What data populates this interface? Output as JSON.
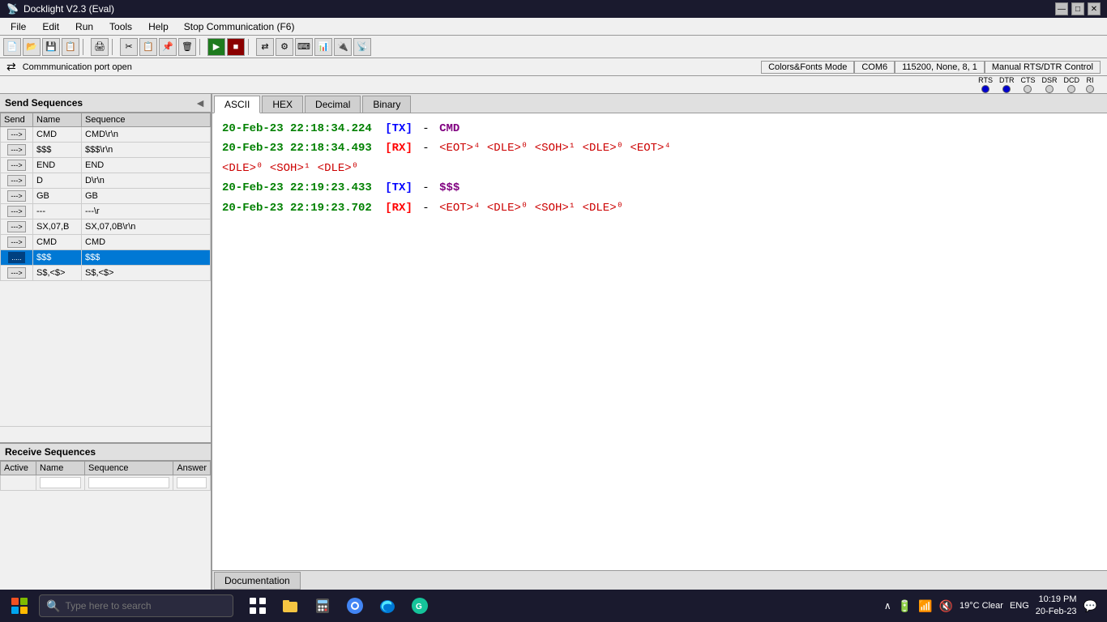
{
  "titleBar": {
    "title": "Docklight V2.3 (Eval)",
    "icon": "📡",
    "controls": [
      "—",
      "□",
      "✕"
    ]
  },
  "menuBar": {
    "items": [
      "File",
      "Edit",
      "Run",
      "Tools",
      "Help"
    ],
    "stopComm": "Stop Communication  (F6)"
  },
  "toolbar": {
    "buttons": [
      "new",
      "open",
      "save",
      "save-as",
      "sep",
      "print",
      "sep",
      "cut",
      "copy",
      "paste",
      "clear",
      "sep",
      "send",
      "stop",
      "sep",
      "settings",
      "channels",
      "keyboard"
    ],
    "portLabel": "Commmunication port open"
  },
  "statusBar": {
    "portStatus": "Commmunication port open",
    "cells": [
      "Colors&Fonts Mode",
      "COM6",
      "115200, None, 8, 1",
      "Manual RTS/DTR Control"
    ]
  },
  "signals": {
    "items": [
      {
        "label": "RTS",
        "on": true
      },
      {
        "label": "DTR",
        "on": true
      },
      {
        "label": "CTS",
        "on": false
      },
      {
        "label": "DSR",
        "on": false
      },
      {
        "label": "DCD",
        "on": false
      },
      {
        "label": "RI",
        "on": false
      }
    ]
  },
  "tabs": {
    "items": [
      "ASCII",
      "HEX",
      "Decimal",
      "Binary"
    ],
    "active": 0
  },
  "sendSequences": {
    "header": "Send Sequences",
    "columns": [
      "Send",
      "Name",
      "Sequence"
    ],
    "rows": [
      {
        "arrow": "--->",
        "name": "CMD",
        "sequence": "CMD\\r\\n"
      },
      {
        "arrow": "--->",
        "name": "$$$",
        "sequence": "$$$\\r\\n"
      },
      {
        "arrow": "--->",
        "name": "END",
        "sequence": "END"
      },
      {
        "arrow": "--->",
        "name": "D",
        "sequence": "D\\r\\n"
      },
      {
        "arrow": "--->",
        "name": "GB",
        "sequence": "GB"
      },
      {
        "arrow": "--->",
        "name": "---",
        "sequence": "---\\r"
      },
      {
        "arrow": "--->",
        "name": "SX,07,B",
        "sequence": "SX,07,0B\\r\\n"
      },
      {
        "arrow": "--->",
        "name": "CMD",
        "sequence": "CMD"
      },
      {
        "arrow": ".....",
        "name": "$$$",
        "sequence": "$$$",
        "selected": true
      },
      {
        "arrow": "--->",
        "name": "S$,<$>",
        "sequence": "S$,<$>"
      }
    ]
  },
  "receiveSequences": {
    "header": "Receive Sequences",
    "columns": [
      "Active",
      "Name",
      "Sequence",
      "Answer"
    ],
    "rows": []
  },
  "commLog": {
    "lines": [
      {
        "timestamp": "20-Feb-23 22:18:34.224",
        "direction": "[TX]",
        "sep": "-",
        "content": "CMD",
        "contentType": "cmd"
      },
      {
        "timestamp": "20-Feb-23 22:18:34.493",
        "direction": "[RX]",
        "sep": "-",
        "content": "<EOT>␄ <DLE>␐ <SOH>␁ <DLE>␐ <EOT>␄",
        "contentType": "rx-data",
        "line2": "<DLE>␐ <SOH>␁ <DLE>␐"
      },
      {
        "timestamp": "20-Feb-23 22:19:23.433",
        "direction": "[TX]",
        "sep": "-",
        "content": "$$$",
        "contentType": "cmd2"
      },
      {
        "timestamp": "20-Feb-23 22:19:23.702",
        "direction": "[RX]",
        "sep": "-",
        "content": "<EOT>␄ <DLE>␐ <SOH>␁ <DLE>␐",
        "contentType": "rx-data2"
      }
    ]
  },
  "docTab": {
    "label": "Documentation"
  },
  "taskbar": {
    "searchPlaceholder": "Type here to search",
    "weather": "19°C  Clear",
    "language": "ENG",
    "time": "10:19 PM",
    "date": "20-Feb-23",
    "taskbarIcons": [
      "task-view",
      "file-explorer",
      "calculator",
      "chrome",
      "edge",
      "grammarly"
    ]
  }
}
